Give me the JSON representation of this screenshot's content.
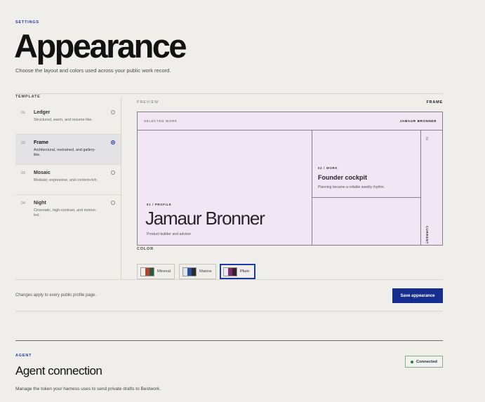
{
  "header": {
    "eyebrow": "SETTINGS",
    "title": "Appearance",
    "subtitle": "Choose the layout and colors used across your public work record."
  },
  "template": {
    "label": "TEMPLATE",
    "items": [
      {
        "num": "01",
        "name": "Ledger",
        "desc": "Structured, warm, and resume-like.",
        "selected": false
      },
      {
        "num": "02",
        "name": "Frame",
        "desc": "Architectural, restrained, and gallery-like.",
        "selected": true
      },
      {
        "num": "03",
        "name": "Mosaic",
        "desc": "Modular, expressive, and content-rich.",
        "selected": false
      },
      {
        "num": "04",
        "name": "Night",
        "desc": "Cinematic, high-contrast, and motion-led.",
        "selected": false
      }
    ]
  },
  "preview": {
    "label": "PREVIEW",
    "frame_label": "FRAME",
    "selected_work": "SELECTED WORK",
    "owner": "JAMAUR BRONNER",
    "profile_eyebrow": "01 / PROFILE",
    "profile_name": "Jamaur Bronner",
    "profile_desc": "Product builder and advisor",
    "work_eyebrow": "02 / WORK",
    "work_title": "Founder cockpit",
    "work_desc": "Planning became a reliable weekly rhythm.",
    "side_num": "03",
    "side_label": "CURRENT",
    "accent_bg": "#f1e6f3",
    "accent_border": "#8c7d8e"
  },
  "color": {
    "label": "COLOR",
    "options": [
      {
        "name": "Mineral",
        "swatch": [
          "#f3efe8",
          "#b24431",
          "#2e5a3a"
        ],
        "selected": false
      },
      {
        "name": "Marine",
        "swatch": [
          "#dfe4ee",
          "#264fa6",
          "#2a2a2a"
        ],
        "selected": false
      },
      {
        "name": "Plum",
        "swatch": [
          "#f1e6f3",
          "#7a2e6b",
          "#3a1d33"
        ],
        "selected": true
      }
    ]
  },
  "footer": {
    "note": "Changes apply to every public profile page.",
    "save_label": "Save appearance"
  },
  "agent": {
    "eyebrow": "AGENT",
    "title": "Agent connection",
    "desc": "Manage the token your harness uses to send private drafts to Bestwork.",
    "status": "Connected",
    "status_color": "#2f7d3d"
  }
}
